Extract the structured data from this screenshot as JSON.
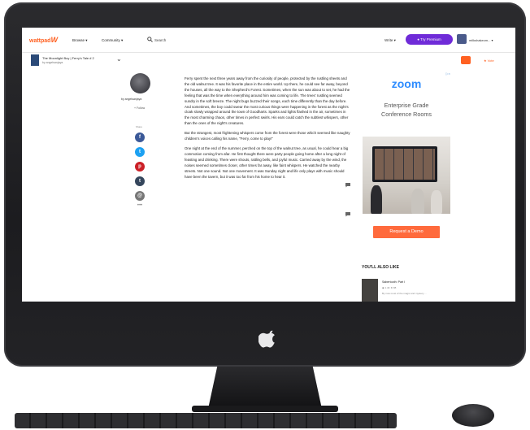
{
  "app": {
    "logo_text": "wattpad",
    "logo_mark": "W"
  },
  "header": {
    "nav": [
      {
        "label": "Browse ▾"
      },
      {
        "label": "Community ▾"
      }
    ],
    "search_label": "Search",
    "write_label": "Write ▾",
    "try_premium_label": "● Try Premium",
    "user_label": "milkshakecm... ▾"
  },
  "story": {
    "title": "The Moonlight Boy | Ferry's Tale # 2",
    "author_line": "by angelsanjaya",
    "vote_label": "★ Vote"
  },
  "author": {
    "by_label": "by angelsanjaya",
    "follow_label": "+ Follow",
    "share_label": "Share"
  },
  "social_icons": [
    {
      "icon": "facebook-icon",
      "glyph": "f",
      "color": "#3b5998"
    },
    {
      "icon": "twitter-icon",
      "glyph": "t",
      "color": "#1da1f2"
    },
    {
      "icon": "pinterest-icon",
      "glyph": "p",
      "color": "#cb2027"
    },
    {
      "icon": "tumblr-icon",
      "glyph": "t",
      "color": "#35465c"
    },
    {
      "icon": "email-icon",
      "glyph": "@",
      "color": "#777777"
    }
  ],
  "more_label": "•••",
  "paragraphs": [
    "Ferry spent the next three years away from the curiosity of people, protected by the rustling sheets and the old walnut tree. It was his favorite place in the entire world. Up there, he could see far away, beyond the houses, all the way to the Shepherd's Forest. Sometimes, when the sun was about to set, he had the feeling that was the time when everything around him was coming to life. The trees' rustling seemed sundry in the soft breeze. The night bugs buzzed their songs, each time differently than the day before. And sometimes, the boy could swear the most curious things were happening in the forest as the night's cloak slowly wrapped around the town of Goodharts. Sparks and lights flashed in the air, sometimes in the most charming chaos, other times in perfect swirls. His ears could catch the subtlest whispers, other than the ones of the night's creatures.",
    "But the strangest, most frightening whispers come from the forest were those which seemed like naughty children's voices calling his name, \"Ferry, come to play!\"",
    "One night at the end of the summer, perched on the top of the walnut tree, as usual, he could hear a big commotion coming from afar. He first thought there were party people going home after a long night of feasting and drinking. There were shouts, rattling bells, and joyful music. Carried away by the wind, the noises seemed sometimes closer, other times far away, like faint whispers. He watched the nearby streets. Not one sound. Not one movement. It was Sunday night and life only plays with music should have been the tavern, but it was too far from his home to hear it."
  ],
  "ad": {
    "mark": "▷×",
    "brand": "zoom",
    "headline_1": "Enterprise Grade",
    "headline_2": "Conference Rooms",
    "cta": "Request a Demo"
  },
  "recommendations": {
    "heading": "YOU'LL ALSO LIKE",
    "items": [
      {
        "title": "Sabertooth: Part I",
        "meta": "◉ 1.4K ★ 88",
        "blurb": "By now most of the magic and mystery ..."
      }
    ]
  },
  "colors": {
    "brand_orange": "#ff6122",
    "premium_purple": "#6f2bd8",
    "zoom_blue": "#2d8cff",
    "cta_orange": "#ff6a3c"
  }
}
